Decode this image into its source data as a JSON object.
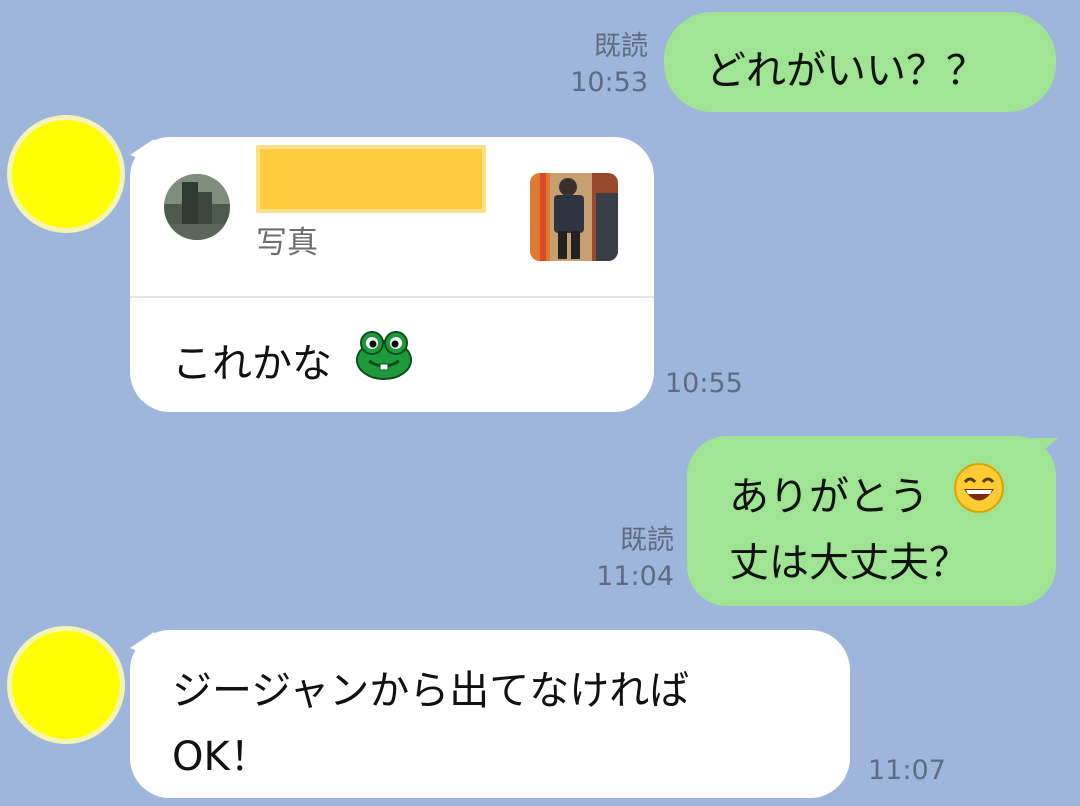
{
  "messages": {
    "m1": {
      "read": "既読",
      "time": "10:53",
      "text": "どれがいい？？"
    },
    "m2": {
      "reply_name": "",
      "reply_type": "写真",
      "text": "これかな",
      "emoji": "frog",
      "time": "10:55"
    },
    "m3": {
      "read": "既読",
      "time": "11:04",
      "line1": "ありがとう",
      "emoji": "grinning-face",
      "line2": "丈は大丈夫？"
    },
    "m4": {
      "line1": "ジージャンから出てなければ",
      "line2": "OK！",
      "time": "11:07"
    }
  },
  "colors": {
    "background": "#9fb6dc",
    "outgoing_bubble": "#9ee493",
    "incoming_bubble": "#ffffff",
    "avatar": "#ffff00",
    "redaction": "#ffcc3d"
  }
}
